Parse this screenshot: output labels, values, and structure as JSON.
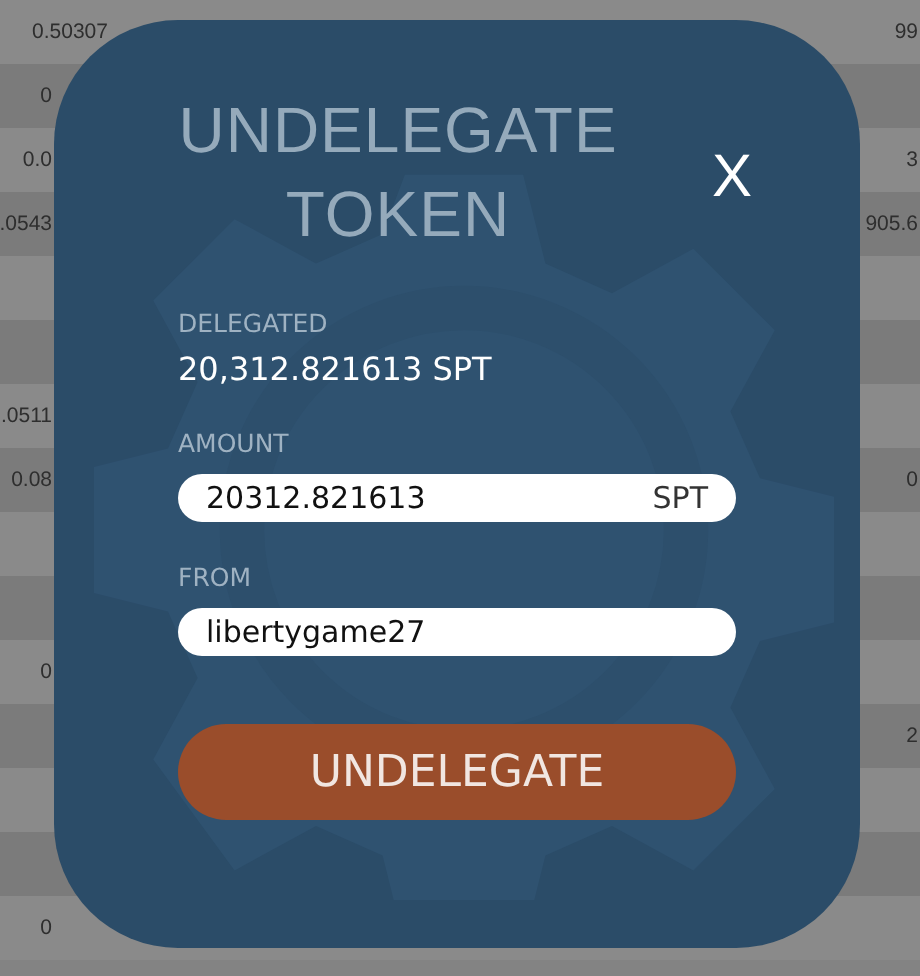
{
  "background_table": {
    "rows": [
      {
        "column_1": "0.50307",
        "column_2": "99"
      },
      {
        "column_1": "0",
        "column_2": ""
      },
      {
        "column_1": "0.0",
        "column_2": "3"
      },
      {
        "column_1": ".0543",
        "column_2": "905.6"
      },
      {
        "column_1": "",
        "column_2": ""
      },
      {
        "column_1": "",
        "column_2": ""
      },
      {
        "column_1": ".0511",
        "column_2": ""
      },
      {
        "column_1": "0.08",
        "column_2": "0"
      },
      {
        "column_1": "",
        "column_2": ""
      },
      {
        "column_1": "",
        "column_2": ""
      },
      {
        "column_1": "0",
        "column_2": ""
      },
      {
        "column_1": "",
        "column_2": "2"
      },
      {
        "column_1": "",
        "column_2": ""
      },
      {
        "column_1": "",
        "column_2": ""
      },
      {
        "column_1": "0",
        "column_2": ""
      }
    ]
  },
  "dialog": {
    "title": "UNDELEGATE TOKEN",
    "close": "X",
    "delegated": {
      "label": "DELEGATED",
      "value": "20,312.821613 SPT"
    },
    "amount": {
      "label": "AMOUNT",
      "value": "20312.821613",
      "unit": "SPT"
    },
    "from": {
      "label": "FROM",
      "value": "libertygame27"
    },
    "button": "UNDELEGATE"
  }
}
